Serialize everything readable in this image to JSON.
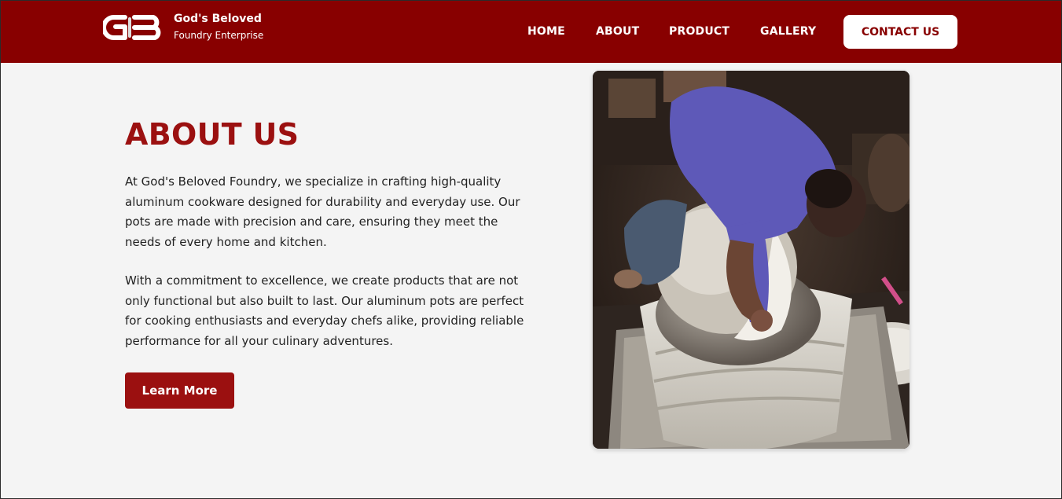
{
  "brand": {
    "logo_text": "GB",
    "name": "God's Beloved",
    "subtitle": "Foundry Enterprise"
  },
  "nav": {
    "items": [
      {
        "label": "HOME"
      },
      {
        "label": "ABOUT"
      },
      {
        "label": "PRODUCT"
      },
      {
        "label": "GALLERY"
      }
    ],
    "contact_label": "CONTACT US"
  },
  "about": {
    "title": "ABOUT US",
    "paragraph1": "At God's Beloved Foundry, we specialize in crafting high-quality aluminum cookware designed for durability and everyday use. Our pots are made with precision and care, ensuring they meet the needs of every home and kitchen.",
    "paragraph2": "With a commitment to excellence, we create products that are not only functional but also built to last. Our aluminum pots are perfect for cooking enthusiasts and everyday chefs alike, providing reliable performance for all your culinary adventures.",
    "button_label": "Learn More"
  },
  "colors": {
    "header_bg": "#880000",
    "accent": "#9b1010",
    "page_bg": "#f4f4f4"
  }
}
